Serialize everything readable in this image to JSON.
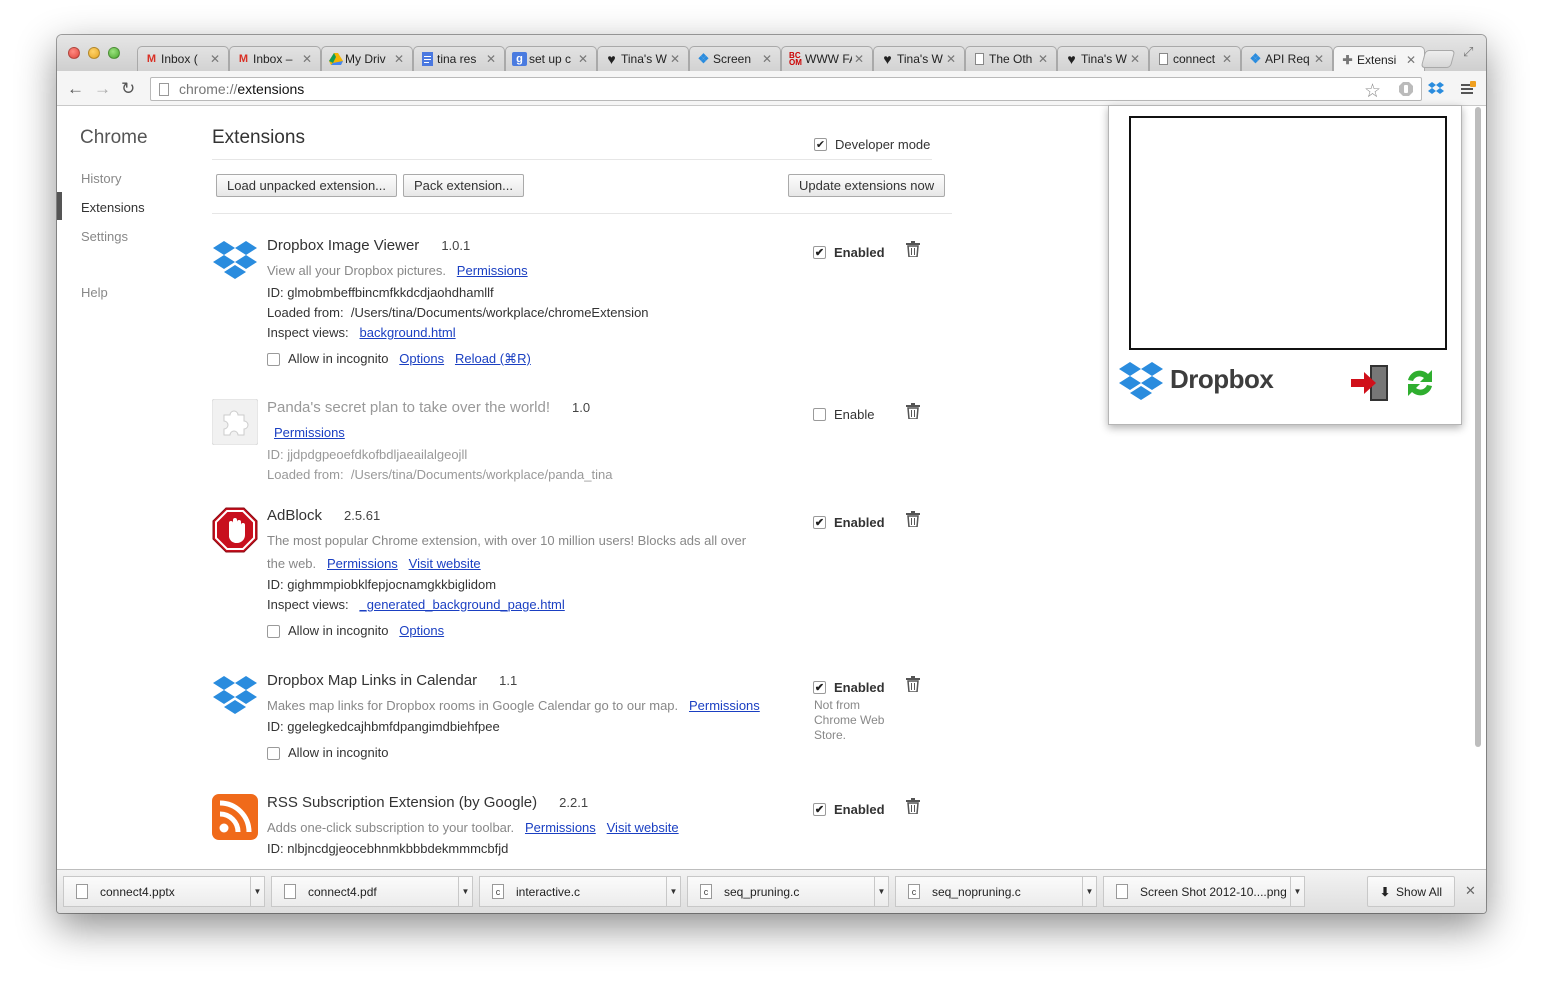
{
  "tabs": [
    {
      "label": "Inbox (",
      "icon": "gmail-icon"
    },
    {
      "label": "Inbox –",
      "icon": "gmail-icon"
    },
    {
      "label": "My Driv",
      "icon": "drive-icon"
    },
    {
      "label": "tina res",
      "icon": "docs-icon"
    },
    {
      "label": "set up c",
      "icon": "google-search-icon"
    },
    {
      "label": "Tina's W",
      "icon": "heart-icon"
    },
    {
      "label": "Screen",
      "icon": "dropbox-icon"
    },
    {
      "label": "WWW FA",
      "icon": "bcom-icon"
    },
    {
      "label": "Tina's W",
      "icon": "heart-icon"
    },
    {
      "label": "The Oth",
      "icon": "page-icon"
    },
    {
      "label": "Tina's W",
      "icon": "heart-icon"
    },
    {
      "label": "connect",
      "icon": "page-icon"
    },
    {
      "label": "API Req",
      "icon": "dropbox-icon"
    },
    {
      "label": "Extensi",
      "icon": "puzzle-icon"
    }
  ],
  "omnibox": {
    "scheme": "chrome://",
    "host": "extensions"
  },
  "sidebar": {
    "title": "Chrome",
    "items": [
      {
        "label": "History"
      },
      {
        "label": "Extensions"
      },
      {
        "label": "Settings"
      },
      {
        "label": "Help"
      }
    ]
  },
  "main": {
    "heading": "Extensions",
    "developer_mode": "Developer mode",
    "buttons": {
      "load_unpacked": "Load unpacked extension...",
      "pack": "Pack extension...",
      "update": "Update extensions now"
    }
  },
  "labels": {
    "enabled": "Enabled",
    "enable": "Enable",
    "permissions": "Permissions",
    "visit_website": "Visit website",
    "allow_incognito": "Allow in incognito",
    "options": "Options",
    "reload": "Reload (⌘R)",
    "inspect_views": "Inspect views:",
    "loaded_from": "Loaded from:",
    "id_prefix": "ID:",
    "not_from_store": "Not from Chrome Web Store."
  },
  "extensions": [
    {
      "name": "Dropbox Image Viewer",
      "version": "1.0.1",
      "description": "View all your Dropbox pictures.",
      "id": "glmobmbeffbincmfkkdcdjaohdhamllf",
      "loaded_from": "/Users/tina/Documents/workplace/chromeExtension",
      "inspect_view": "background.html"
    },
    {
      "name": "Panda's secret plan to take over the world!",
      "version": "1.0",
      "id": "jjdpdgpeoefdkofbdljaeailalgeojll",
      "loaded_from": "/Users/tina/Documents/workplace/panda_tina"
    },
    {
      "name": "AdBlock",
      "version": "2.5.61",
      "description": "The most popular Chrome extension, with over 10 million users! Blocks ads all over",
      "description2": "the web.",
      "id": "gighmmpiobklfepjocnamgkkbiglidom",
      "inspect_view": "_generated_background_page.html"
    },
    {
      "name": "Dropbox Map Links in Calendar",
      "version": "1.1",
      "description": "Makes map links for Dropbox rooms in Google Calendar go to our map.",
      "id": "ggelegkedcajhbmfdpangimdbiehfpee"
    },
    {
      "name": "RSS Subscription Extension (by Google)",
      "version": "2.2.1",
      "description": "Adds one-click subscription to your toolbar.",
      "id": "nlbjncdgjeocebhnmkbbbdekmmmcbfjd"
    }
  ],
  "popup": {
    "brand": "Dropbox"
  },
  "downloads": [
    {
      "name": "connect4.pptx"
    },
    {
      "name": "connect4.pdf"
    },
    {
      "name": "interactive.c"
    },
    {
      "name": "seq_pruning.c"
    },
    {
      "name": "seq_nopruning.c"
    },
    {
      "name": "Screen Shot 2012-10....png"
    }
  ],
  "shelf": {
    "show_all": "Show All"
  },
  "colors": {
    "link": "#1a3fc2",
    "dropbox_blue": "#2a8cde",
    "adblock_red": "#c8101e",
    "rss_orange": "#f06a1a"
  }
}
